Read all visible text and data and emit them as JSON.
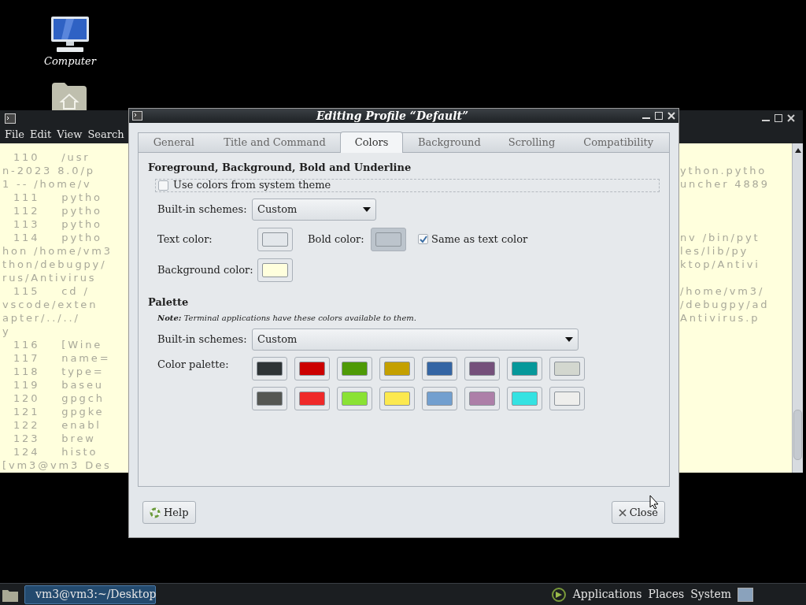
{
  "desktop": {
    "icons": [
      {
        "kind": "computer",
        "label": "Computer"
      },
      {
        "kind": "home-folder"
      }
    ]
  },
  "terminal": {
    "menu": [
      "File",
      "Edit",
      "View",
      "Search"
    ],
    "lines": [
      {
        "left": "  110    /usr"
      },
      {
        "left": "n-2023 8.0/p",
        "right": "ython.pytho"
      },
      {
        "left": "1 -- /home/v",
        "right": "uncher 4889"
      },
      {
        "left": "  111    pytho"
      },
      {
        "left": "  112    pytho"
      },
      {
        "left": "  113    pytho"
      },
      {
        "left": "  114    pytho",
        "right": "nv /bin/pyt"
      },
      {
        "left": "hon /home/vm3",
        "right": "les/lib/py"
      },
      {
        "left": "thon/debugpy/",
        "right": "ktop/Antivi"
      },
      {
        "left": "rus/Antivirus"
      },
      {
        "left": "  115    cd /",
        "right": "/home/vm3/"
      },
      {
        "left": "vscode/exten",
        "right": "/debugpy/ad"
      },
      {
        "left": "apter/../../",
        "right": "Antivirus.p"
      },
      {
        "left": "y"
      },
      {
        "left": "  116    [Wine"
      },
      {
        "left": "  117    name="
      },
      {
        "left": "  118    type="
      },
      {
        "left": "  119    baseu"
      },
      {
        "left": "  120    gpgch"
      },
      {
        "left": "  121    gpgke"
      },
      {
        "left": "  122    enabl"
      },
      {
        "left": "  123    brew"
      },
      {
        "left": "  124    histo"
      },
      {
        "left": "[vm3@vm3 Des"
      }
    ]
  },
  "dialog": {
    "title": "Editing Profile “Default”",
    "tabs": [
      {
        "label": "General",
        "selected": false
      },
      {
        "label": "Title and Command",
        "selected": false
      },
      {
        "label": "Colors",
        "selected": true
      },
      {
        "label": "Background",
        "selected": false
      },
      {
        "label": "Scrolling",
        "selected": false
      },
      {
        "label": "Compatibility",
        "selected": false
      }
    ],
    "foreground": {
      "title": "Foreground, Background, Bold and Underline",
      "use_system_colors": {
        "label": "Use colors from system theme",
        "checked": false
      },
      "schemes": {
        "label": "Built-in schemes:",
        "value": "Custom"
      },
      "text_color": {
        "label": "Text color:",
        "color": "#e3e7eb"
      },
      "bold_color": {
        "label": "Bold color:",
        "color": "#bcc4cc",
        "disabled": true
      },
      "same_as_text": {
        "label": "Same as text color",
        "checked": true
      },
      "background_color": {
        "label": "Background color:",
        "color": "#ffffdd"
      }
    },
    "palette": {
      "title": "Palette",
      "note": "**Note:** Terminal applications have these colors available to them.",
      "schemes": {
        "label": "Built-in schemes:",
        "value": "Custom"
      },
      "label": "Color palette:",
      "colors": [
        {
          "color": "#2e3436"
        },
        {
          "color": "#cc0000"
        },
        {
          "color": "#4e9a06"
        },
        {
          "color": "#c4a000"
        },
        {
          "color": "#3465a4"
        },
        {
          "color": "#75507b"
        },
        {
          "color": "#06989a"
        },
        {
          "color": "#d3d7cf"
        },
        {
          "color": "#555753"
        },
        {
          "color": "#ef2929"
        },
        {
          "color": "#8ae234"
        },
        {
          "color": "#fce94f"
        },
        {
          "color": "#729fcf"
        },
        {
          "color": "#ad7fa8"
        },
        {
          "color": "#34e2e2"
        },
        {
          "color": "#eeeeec"
        }
      ]
    },
    "buttons": [
      {
        "kind": "help",
        "label": "Help"
      },
      {
        "kind": "close",
        "label": "Close"
      }
    ]
  },
  "taskbar": {
    "tasks": [
      {
        "label": "vm3@vm3:~/Desktop",
        "selected": true
      }
    ],
    "menus": [
      "Applications",
      "Places",
      "System"
    ]
  }
}
